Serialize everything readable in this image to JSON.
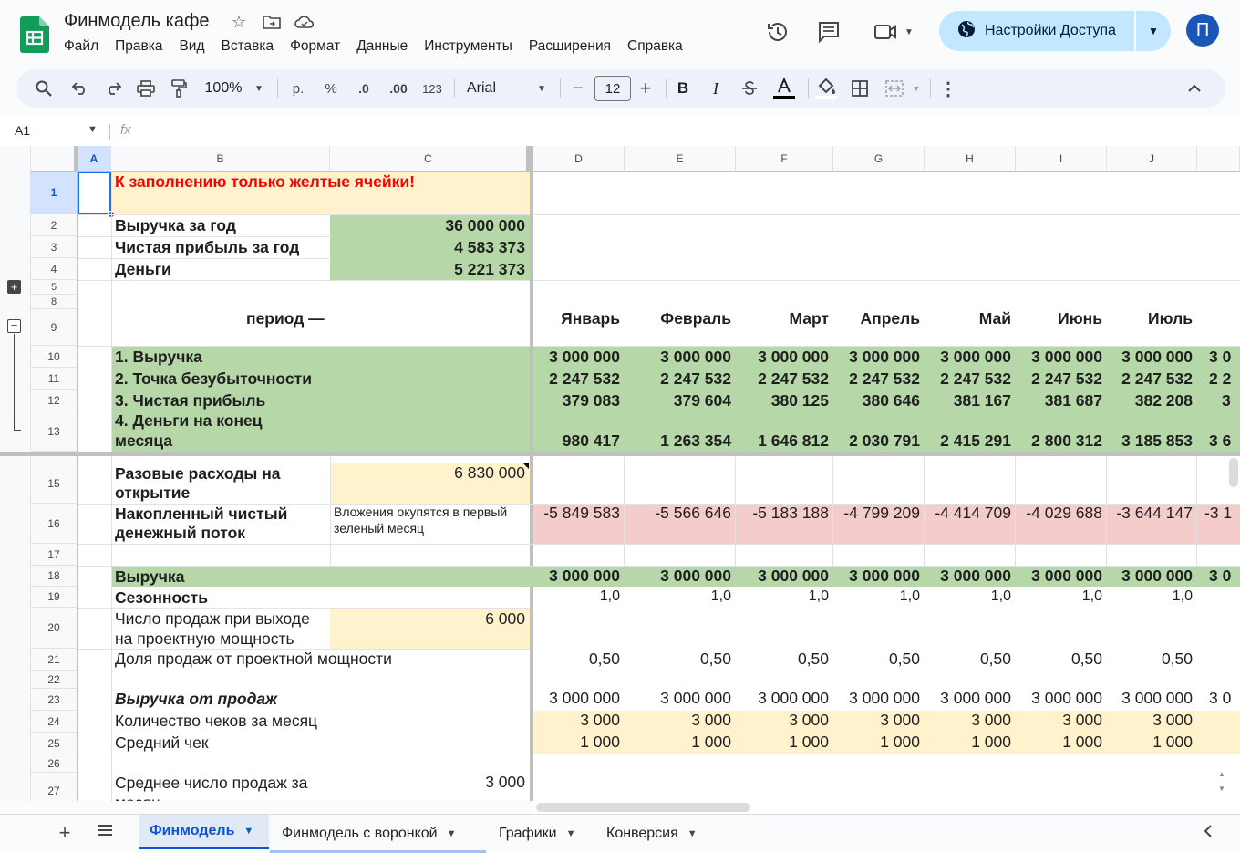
{
  "app": {
    "title": "Финмодель кафе",
    "menu": [
      "Файл",
      "Правка",
      "Вид",
      "Вставка",
      "Формат",
      "Данные",
      "Инструменты",
      "Расширения",
      "Справка"
    ],
    "share_label": "Настройки Доступа",
    "avatar_letter": "П"
  },
  "toolbar": {
    "zoom": "100%",
    "currency": "р.",
    "percent": "%",
    "dec_less": ".0",
    "dec_more": ".00",
    "format_123": "123",
    "font": "Arial",
    "font_size": "12",
    "bold": "B",
    "italic": "I"
  },
  "formula_bar": {
    "cell_ref": "A1",
    "fx": "fx"
  },
  "columns": [
    "A",
    "B",
    "C",
    "D",
    "E",
    "F",
    "G",
    "H",
    "I",
    "J"
  ],
  "months": [
    "Январь",
    "Февраль",
    "Март",
    "Апрель",
    "Май",
    "Июнь",
    "Июль"
  ],
  "sheet": {
    "r1": "К заполнению только желтые ячейки!",
    "r2_label": "Выручка за год",
    "r2_value": "36 000 000",
    "r3_label": "Чистая прибыль за год",
    "r3_value": "4 583 373",
    "r4_label": "Деньги",
    "r4_value": "5 221 373",
    "r9_label": "период —",
    "r10_label": "1. Выручка",
    "r11_label": "2. Точка безубыточности",
    "r12_label": "3. Чистая прибыль",
    "r13_label_1": "4. Деньги на конец",
    "r13_label_2": "месяца",
    "r15_label_1": "Разовые расходы на",
    "r15_label_2": "открытие",
    "r15_value": "6 830 000",
    "r16_label_1": "Накопленный чистый",
    "r16_label_2": "денежный поток",
    "r16_note_1": "Вложения окупятся в первый",
    "r16_note_2": "зеленый месяц",
    "r18_label": "Выручка",
    "r19_label": "Сезонность",
    "r20_label_1": "Число продаж при выходе",
    "r20_label_2": "на проектную мощность",
    "r20_value": "6 000",
    "r21_label": "Доля продаж от проектной мощности",
    "r23_label": "Выручка от продаж",
    "r24_label": "Количество чеков за месяц",
    "r25_label": "Средний чек",
    "r27_label_1": "Среднее число продаж за",
    "r27_label_2": "месяц",
    "r27_value": "3 000"
  },
  "rows_data": {
    "r10": [
      "3 000 000",
      "3 000 000",
      "3 000 000",
      "3 000 000",
      "3 000 000",
      "3 000 000",
      "3 000 000",
      "3 0"
    ],
    "r11": [
      "2 247 532",
      "2 247 532",
      "2 247 532",
      "2 247 532",
      "2 247 532",
      "2 247 532",
      "2 247 532",
      "2 2"
    ],
    "r12": [
      "379 083",
      "379 604",
      "380 125",
      "380 646",
      "381 167",
      "381 687",
      "382 208",
      "3"
    ],
    "r13": [
      "980 417",
      "1 263 354",
      "1 646 812",
      "2 030 791",
      "2 415 291",
      "2 800 312",
      "3 185 853",
      "3 6"
    ],
    "r16": [
      "-5 849 583",
      "-5 566 646",
      "-5 183 188",
      "-4 799 209",
      "-4 414 709",
      "-4 029 688",
      "-3 644 147",
      "-3 1"
    ],
    "r18": [
      "3 000 000",
      "3 000 000",
      "3 000 000",
      "3 000 000",
      "3 000 000",
      "3 000 000",
      "3 000 000",
      "3 0"
    ],
    "r19": [
      "1,0",
      "1,0",
      "1,0",
      "1,0",
      "1,0",
      "1,0",
      "1,0"
    ],
    "r21": [
      "0,50",
      "0,50",
      "0,50",
      "0,50",
      "0,50",
      "0,50",
      "0,50"
    ],
    "r23": [
      "3 000 000",
      "3 000 000",
      "3 000 000",
      "3 000 000",
      "3 000 000",
      "3 000 000",
      "3 000 000",
      "3 0"
    ],
    "r24": [
      "3 000",
      "3 000",
      "3 000",
      "3 000",
      "3 000",
      "3 000",
      "3 000"
    ],
    "r25": [
      "1 000",
      "1 000",
      "1 000",
      "1 000",
      "1 000",
      "1 000",
      "1 000"
    ]
  },
  "row_numbers": [
    "1",
    "2",
    "3",
    "4",
    "5",
    "8",
    "9",
    "10",
    "11",
    "12",
    "13",
    "15",
    "16",
    "17",
    "18",
    "19",
    "20",
    "21",
    "22",
    "23",
    "24",
    "25",
    "26",
    "27"
  ],
  "sheet_tabs": [
    "Финмодель",
    "Финмодель с воронкой",
    "Графики",
    "Конверсия"
  ],
  "colors": {
    "green": "#b6d7a8",
    "yellow": "#fff2cc",
    "pink": "#f4cccc",
    "accent": "#0b57d0"
  }
}
